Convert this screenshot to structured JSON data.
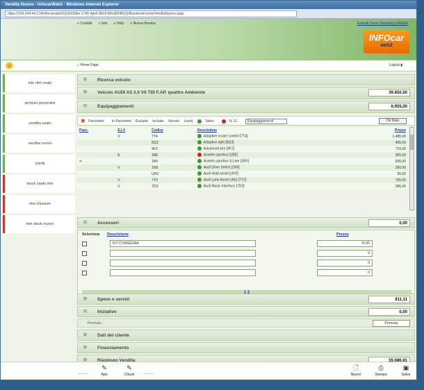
{
  "window": {
    "title": "Vendita Nuovo - InfocarWeb2 - Windows Internet Explorer",
    "url": "https://194.244.44.174/infocarweb2/(S(4r2f3lbe-1780-4de5-80c6-f0fcd654f52))/BusinessForms/VenditaNuovo.aspx"
  },
  "topnav": {
    "items": [
      "Contatti",
      "Info",
      "Help",
      "Nuova finestra"
    ],
    "links": "Estendi Corso Marketing PREDA"
  },
  "logo": {
    "line1": "INFOcar",
    "line2": "web2"
  },
  "crumb": {
    "home": "Home Page",
    "logout": "Logout"
  },
  "sidebar": {
    "items": [
      {
        "label": "mie ritiri usato",
        "accent": "green"
      },
      {
        "label": "archivio preventivi",
        "accent": "green"
      },
      {
        "label": "vendita usato",
        "accent": "green"
      },
      {
        "label": "vendita nuovo",
        "accent": "green"
      },
      {
        "label": "clienti",
        "accent": "green"
      },
      {
        "label": "stock usato mio",
        "accent": "red"
      },
      {
        "label": "mie chiusure",
        "accent": "red"
      },
      {
        "label": "mie stock nuovo",
        "accent": "red"
      }
    ]
  },
  "sections": {
    "ricerca": "Ricerca veicolo",
    "veicolo": "Veicolo AUDI A5 3.0 V6 TDI F.AP. quattro Ambiente",
    "veicolo_total": "39.850,50",
    "equip": "Equipaggiamenti",
    "equip_total": "6.955,00"
  },
  "toolbar": {
    "items": [
      "Pacchetto",
      "In Pacchetto",
      "Esclude",
      "Include",
      "Vincolo",
      "Livery",
      "Selez",
      "N. D."
    ],
    "select_value": "Equipaggiamenti",
    "button": "Ok Dato"
  },
  "options": {
    "headers": [
      "Pacc.",
      "E.I.V",
      "Codice",
      "Descrizione",
      "Prezzo"
    ],
    "rows": [
      {
        "pacc": "",
        "eiv": "V",
        "code": "7T4",
        "status": "ok",
        "desc": "Adaptive cruise control [7T4]",
        "price": "1.485,00"
      },
      {
        "pacc": "",
        "eiv": "",
        "code": "8Q3",
        "status": "ok",
        "desc": "Adaptive light [8Q3]",
        "price": "405,00"
      },
      {
        "pacc": "",
        "eiv": "",
        "code": "4F2",
        "status": "ok",
        "desc": "Advanced key [4F2]",
        "price": "710,00"
      },
      {
        "pacc": "",
        "eiv": "E",
        "code": "1BE",
        "status": "ko",
        "desc": "Assetto sportivo [1BE]",
        "price": "305,00"
      },
      {
        "pacc": "pkg",
        "eiv": "",
        "code": "1BV",
        "status": "ok",
        "desc": "Assetto sportivo S-Line [1BV]",
        "price": "695,00"
      },
      {
        "pacc": "",
        "eiv": "V",
        "code": "1N5",
        "status": "ok",
        "desc": "Audi Drive Select [1N5]",
        "price": "350,00"
      },
      {
        "pacc": "",
        "eiv": "",
        "code": "UH2",
        "status": "ok",
        "desc": "Audi Hold assist [UH2]",
        "price": "95,00"
      },
      {
        "pacc": "",
        "eiv": "V",
        "code": "7Y2",
        "status": "ok",
        "desc": "Audi Lane Assist (AS) [7Y2]",
        "price": "735,00"
      },
      {
        "pacc": "",
        "eiv": "V",
        "code": "7D3",
        "status": "ok",
        "desc": "Audi Music Interface [7D3]",
        "price": "285,00"
      }
    ]
  },
  "accessori": {
    "title": "Accessori",
    "total": "0,00",
    "head_sel": "Seleziona",
    "head_desc": "Descrizione",
    "head_price": "Prezzo",
    "rows": [
      {
        "desc": "KIT CONSEGNA",
        "price": "70,00"
      },
      {
        "desc": "",
        "price": "0"
      },
      {
        "desc": "",
        "price": "0"
      },
      {
        "desc": "",
        "price": "0"
      }
    ],
    "pager": "1 2"
  },
  "lower": {
    "spese": "Spese e servizi",
    "spese_total": "811,11",
    "iniziative": "Iniziative",
    "iniziative_total": "0,00",
    "permuta": "Permuta -",
    "permuta_btn": "Permuta",
    "dati": "Dati del cliente",
    "finanziamento": "Finanziamento",
    "riepilogo": "Riepilogo Vendita",
    "riepilogo_total": "55.686,81"
  },
  "bottom": {
    "apri": "Apri",
    "chiudi": "Chiudi",
    "nuovo": "Nuovo",
    "stampa": "Stampa",
    "salva": "Salva"
  }
}
